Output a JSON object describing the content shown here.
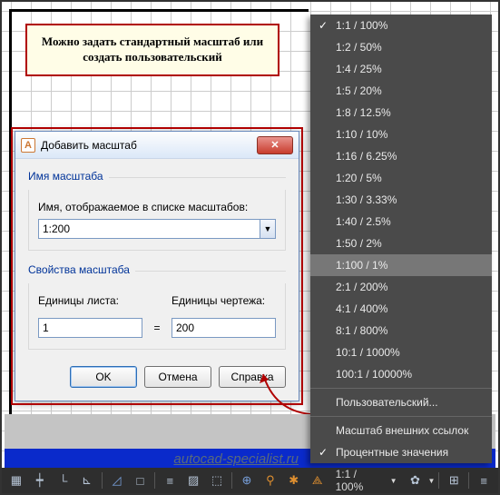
{
  "callout": {
    "text": "Можно задать стандартный масштаб или создать пользовательский"
  },
  "dialog": {
    "title": "Добавить масштаб",
    "group_name_label": "Имя масштаба",
    "name_field_label": "Имя, отображаемое в списке масштабов:",
    "name_value": "1:200",
    "group_props_label": "Свойства масштаба",
    "paper_units_label": "Единицы листа:",
    "drawing_units_label": "Единицы чертежа:",
    "paper_units_value": "1",
    "drawing_units_value": "200",
    "equals": "=",
    "ok": "OK",
    "cancel": "Отмена",
    "help": "Справка",
    "app_icon_letter": "A"
  },
  "menu": {
    "items": [
      {
        "label": "1:1 / 100%",
        "checked": true
      },
      {
        "label": "1:2 / 50%"
      },
      {
        "label": "1:4 / 25%"
      },
      {
        "label": "1:5 / 20%"
      },
      {
        "label": "1:8 / 12.5%"
      },
      {
        "label": "1:10 / 10%"
      },
      {
        "label": "1:16 / 6.25%"
      },
      {
        "label": "1:20 / 5%"
      },
      {
        "label": "1:30 / 3.33%"
      },
      {
        "label": "1:40 / 2.5%"
      },
      {
        "label": "1:50 / 2%"
      },
      {
        "label": "1:100 / 1%",
        "selected": true
      },
      {
        "label": "2:1 / 200%"
      },
      {
        "label": "4:1 / 400%"
      },
      {
        "label": "8:1 / 800%"
      },
      {
        "label": "10:1 / 1000%"
      },
      {
        "label": "100:1 / 10000%"
      },
      {
        "label": "Пользовательский..."
      }
    ],
    "xref_label": "Масштаб внешних ссылок",
    "percent_label": "Процентные значения"
  },
  "statusbar": {
    "scale_display": "1:1 / 100%"
  },
  "watermark": "autocad-specialist.ru"
}
